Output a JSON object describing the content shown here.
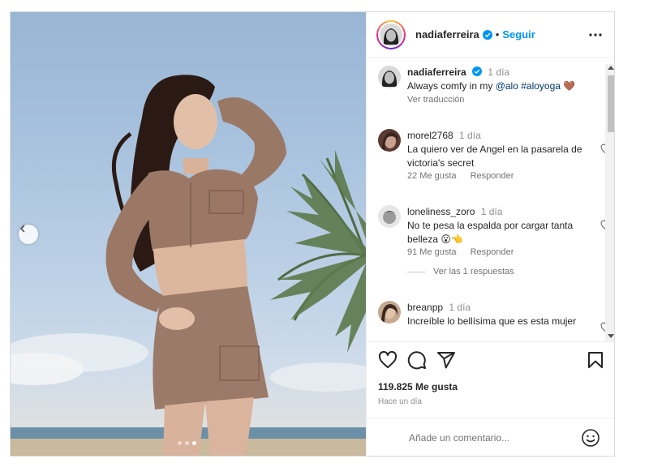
{
  "post": {
    "author": "nadiaferreira",
    "follow_label": "Seguir",
    "separator": "•",
    "more_icon": "more-horizontal-icon",
    "media_dots": 3,
    "media_active_dot": 3
  },
  "caption": {
    "user": "nadiaferreira",
    "time": "1 día",
    "text_prefix": "Always comfy in my ",
    "mention": "@alo",
    "hashtag": "#aloyoga",
    "emoji": "🤎",
    "translate_label": "Ver traducción"
  },
  "comments": [
    {
      "user": "morel2768",
      "time": "1 día",
      "text": "La quiero ver de Angel en la pasarela de victoria's secret",
      "likes": "22 Me gusta",
      "reply": "Responder"
    },
    {
      "user": "loneliness_zoro",
      "time": "1 día",
      "text": "No te pesa la espalda por cargar tanta belleza 😮👈",
      "likes": "91 Me gusta",
      "reply": "Responder",
      "replies_label": "Ver las 1 respuestas"
    },
    {
      "user": "breanpp",
      "time": "1 día",
      "text": "Increíble lo bellísima que es esta mujer",
      "likes": "",
      "reply": ""
    }
  ],
  "actions": {
    "likes": "119.825 Me gusta",
    "date": "Hace un día",
    "icons": [
      "heart-icon",
      "comment-icon",
      "share-icon",
      "bookmark-icon"
    ]
  },
  "composer": {
    "placeholder": "Añade un comentario...",
    "emoji_icon": "smiley-icon"
  },
  "colors": {
    "link": "#0095f6",
    "text": "#262626",
    "muted": "#737373",
    "border": "#dbdbdb"
  }
}
